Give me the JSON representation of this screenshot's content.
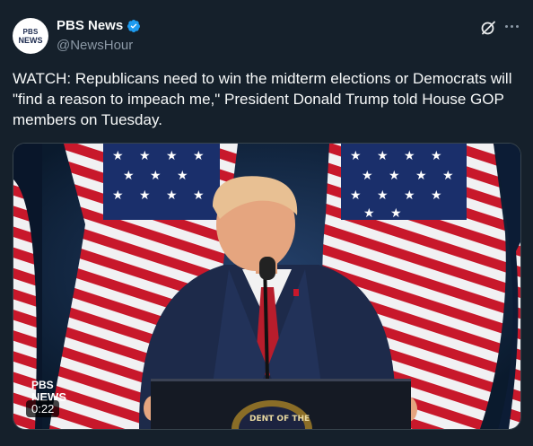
{
  "account": {
    "name": "PBS News",
    "handle": "@NewsHour",
    "avatar_logo_top": "PBS",
    "avatar_logo_bottom": "NEWS",
    "verified_color": "#1d9bf0"
  },
  "tweet": {
    "text": "WATCH: Republicans need to win the midterm elections or Democrats will \"find a reason to impeach me,\" President Donald Trump told House GOP members on Tuesday."
  },
  "media": {
    "duration": "0:22",
    "watermark_top": "PBS",
    "watermark_bottom": "NEWS",
    "seal_text": "DENT OF THE"
  },
  "icons": {
    "verified": "verified-badge-icon",
    "grok": "grok-icon",
    "more": "more-options-icon",
    "pbs": "pbs-logo-icon"
  },
  "colors": {
    "background": "#15202b",
    "text": "#f7f9f9",
    "secondary": "#8b98a5"
  }
}
